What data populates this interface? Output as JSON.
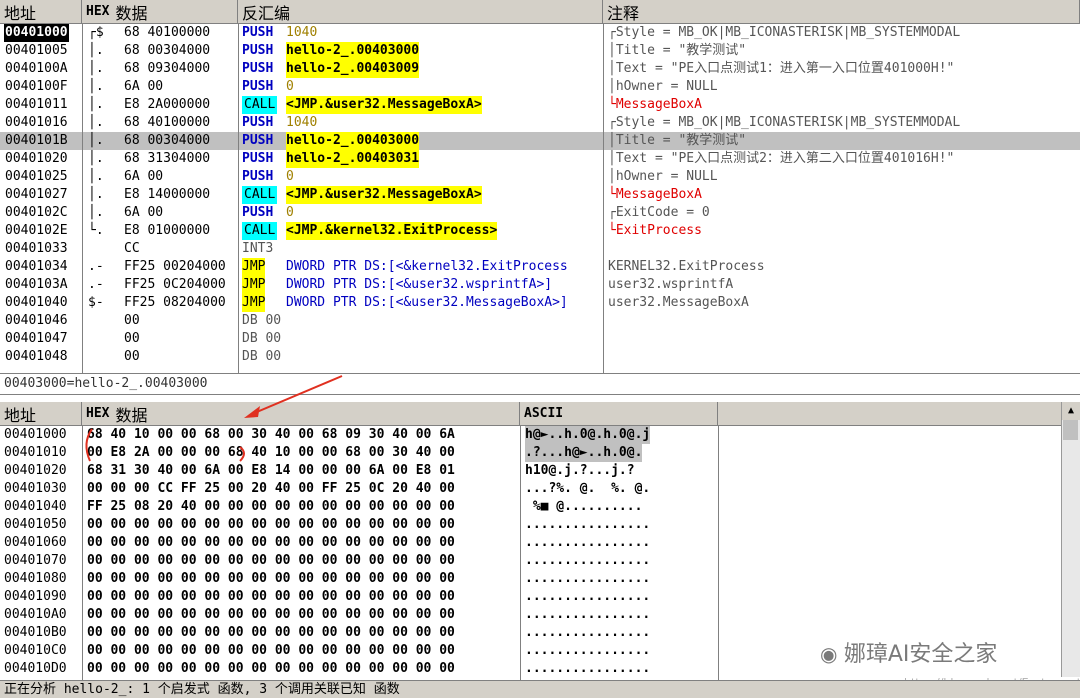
{
  "disasm_headers": {
    "addr": "地址",
    "hex_b": "HEX",
    "hex": "数据",
    "disasm": "反汇编",
    "comment": "注释"
  },
  "disasm_rows": [
    {
      "addr": "00401000",
      "marker": "┌$",
      "hex": "68 40100000",
      "mnem": "PUSH",
      "arg": "1040",
      "comment": "┌Style = MB_OK|MB_ICONASTERISK|MB_SYSTEMMODAL"
    },
    {
      "addr": "00401005",
      "marker": "│.",
      "hex": "68 00304000",
      "mnem": "PUSH",
      "arg": "hello-2_.00403000",
      "comment": "│Title = \"教学测试\""
    },
    {
      "addr": "0040100A",
      "marker": "│.",
      "hex": "68 09304000",
      "mnem": "PUSH",
      "arg": "hello-2_.00403009",
      "comment": "│Text = \"PE入口点测试1：进入第一入口位置401000H!\""
    },
    {
      "addr": "0040100F",
      "marker": "│.",
      "hex": "6A 00",
      "mnem": "PUSH",
      "arg": "0",
      "comment": "│hOwner = NULL"
    },
    {
      "addr": "00401011",
      "marker": "│.",
      "hex": "E8 2A000000",
      "mnem": "CALL",
      "arg": "<JMP.&user32.MessageBoxA>",
      "comment": "└MessageBoxA"
    },
    {
      "addr": "00401016",
      "marker": "│.",
      "hex": "68 40100000",
      "mnem": "PUSH",
      "arg": "1040",
      "comment": "┌Style = MB_OK|MB_ICONASTERISK|MB_SYSTEMMODAL"
    },
    {
      "addr": "0040101B",
      "marker": "│.",
      "hex": "68 00304000",
      "mnem": "PUSH",
      "arg": "hello-2_.00403000",
      "comment": "│Title = \"教学测试\""
    },
    {
      "addr": "00401020",
      "marker": "│.",
      "hex": "68 31304000",
      "mnem": "PUSH",
      "arg": "hello-2_.00403031",
      "comment": "│Text = \"PE入口点测试2：进入第二入口位置401016H!\""
    },
    {
      "addr": "00401025",
      "marker": "│.",
      "hex": "6A 00",
      "mnem": "PUSH",
      "arg": "0",
      "comment": "│hOwner = NULL"
    },
    {
      "addr": "00401027",
      "marker": "│.",
      "hex": "E8 14000000",
      "mnem": "CALL",
      "arg": "<JMP.&user32.MessageBoxA>",
      "comment": "└MessageBoxA"
    },
    {
      "addr": "0040102C",
      "marker": "│.",
      "hex": "6A 00",
      "mnem": "PUSH",
      "arg": "0",
      "comment": "┌ExitCode = 0"
    },
    {
      "addr": "0040102E",
      "marker": "└.",
      "hex": "E8 01000000",
      "mnem": "CALL",
      "arg": "<JMP.&kernel32.ExitProcess>",
      "comment": "└ExitProcess"
    },
    {
      "addr": "00401033",
      "marker": "",
      "hex": "CC",
      "mnem": "INT3",
      "arg": "",
      "comment": ""
    },
    {
      "addr": "00401034",
      "marker": ".-",
      "hex": "FF25 00204000",
      "mnem": "JMP",
      "arg": "DWORD PTR DS:[<&kernel32.ExitProcess",
      "comment": "KERNEL32.ExitProcess"
    },
    {
      "addr": "0040103A",
      "marker": ".-",
      "hex": "FF25 0C204000",
      "mnem": "JMP",
      "arg": "DWORD PTR DS:[<&user32.wsprintfA>]",
      "comment": "user32.wsprintfA"
    },
    {
      "addr": "00401040",
      "marker": "$-",
      "hex": "FF25 08204000",
      "mnem": "JMP",
      "arg": "DWORD PTR DS:[<&user32.MessageBoxA>]",
      "comment": "user32.MessageBoxA"
    },
    {
      "addr": "00401046",
      "marker": "",
      "hex": "00",
      "mnem": "DB 00",
      "arg": "",
      "comment": ""
    },
    {
      "addr": "00401047",
      "marker": "",
      "hex": "00",
      "mnem": "DB 00",
      "arg": "",
      "comment": ""
    },
    {
      "addr": "00401048",
      "marker": "",
      "hex": "00",
      "mnem": "DB 00",
      "arg": "",
      "comment": ""
    }
  ],
  "info_line": "00403000=hello-2_.00403000",
  "dump_headers": {
    "addr": "地址",
    "hex_b": "HEX",
    "hex": "数据",
    "ascii": "ASCII"
  },
  "dump_rows": [
    {
      "addr": "00401000",
      "hex": "68 40 10 00 00 68 00 30 40 00 68 09 30 40 00 6A",
      "ascii": "h@►..h.0@.h.0@.j"
    },
    {
      "addr": "00401010",
      "hex": "00 E8 2A 00 00 00 68 40 10 00 00 68 00 30 40 00",
      "ascii": ".?...h@►..h.0@."
    },
    {
      "addr": "00401020",
      "hex": "68 31 30 40 00 6A 00 E8 14 00 00 00 6A 00 E8 01",
      "ascii": "h10@.j.?...j.?"
    },
    {
      "addr": "00401030",
      "hex": "00 00 00 CC FF 25 00 20 40 00 FF 25 0C 20 40 00",
      "ascii": "...?%. @.  %. @."
    },
    {
      "addr": "00401040",
      "hex": "FF 25 08 20 40 00 00 00 00 00 00 00 00 00 00 00",
      "ascii": " %■ @.........."
    },
    {
      "addr": "00401050",
      "hex": "00 00 00 00 00 00 00 00 00 00 00 00 00 00 00 00",
      "ascii": "................"
    },
    {
      "addr": "00401060",
      "hex": "00 00 00 00 00 00 00 00 00 00 00 00 00 00 00 00",
      "ascii": "................"
    },
    {
      "addr": "00401070",
      "hex": "00 00 00 00 00 00 00 00 00 00 00 00 00 00 00 00",
      "ascii": "................"
    },
    {
      "addr": "00401080",
      "hex": "00 00 00 00 00 00 00 00 00 00 00 00 00 00 00 00",
      "ascii": "................"
    },
    {
      "addr": "00401090",
      "hex": "00 00 00 00 00 00 00 00 00 00 00 00 00 00 00 00",
      "ascii": "................"
    },
    {
      "addr": "004010A0",
      "hex": "00 00 00 00 00 00 00 00 00 00 00 00 00 00 00 00",
      "ascii": "................"
    },
    {
      "addr": "004010B0",
      "hex": "00 00 00 00 00 00 00 00 00 00 00 00 00 00 00 00",
      "ascii": "................"
    },
    {
      "addr": "004010C0",
      "hex": "00 00 00 00 00 00 00 00 00 00 00 00 00 00 00 00",
      "ascii": "................"
    },
    {
      "addr": "004010D0",
      "hex": "00 00 00 00 00 00 00 00 00 00 00 00 00 00 00 00",
      "ascii": "................"
    }
  ],
  "status": "正在分析 hello-2_: 1 个启发式 函数, 3 个调用关联已知 函数",
  "watermark": "娜璋AI安全之家",
  "watermark_url": "https://blog.csdn.net/Eastmount",
  "colors": {
    "yellow": "#ffff00",
    "cyan": "#00ffff",
    "blue": "#0000c0",
    "red": "#e00000",
    "arrow": "#e03020"
  }
}
